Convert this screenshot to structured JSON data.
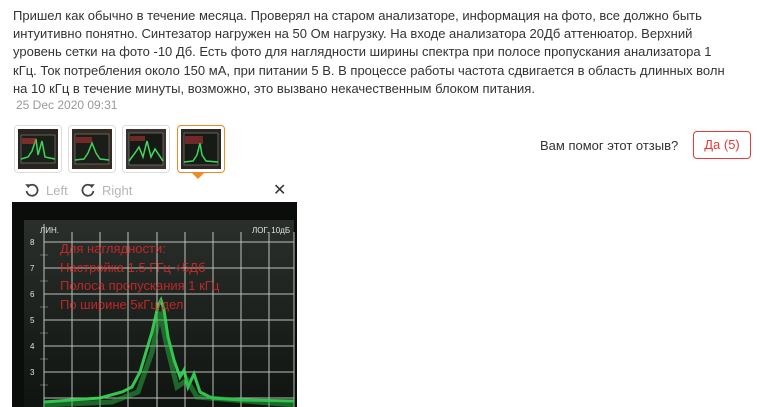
{
  "review": {
    "text": "Пришел как обычно в течение месяца. Проверял на старом анализаторе, информация на фото, все должно быть интуитивно понятно. Синтезатор нагружен на 50 Ом нагрузку. На входе анализатора 20Дб аттенюатор. Верхний уровень сетки на фото -10 Дб. Есть фото для наглядности ширины спектра при полосе пропускания анализатора 1 кГц. Ток потребления около 150 мА, при питании 5 В. В процессе работы частота сдвигается в область длинных волн на 10 кГц в течение минуты, возможно, это вызвано некачественным блоком питания.",
    "date": "25 Dec 2020 09:31"
  },
  "thumbnails": [
    {
      "name": "photo-1"
    },
    {
      "name": "photo-2"
    },
    {
      "name": "photo-3"
    },
    {
      "name": "photo-4",
      "active": true
    }
  ],
  "helpful": {
    "question": "Вам помог этот отзыв?",
    "yes_label": "Да (5)"
  },
  "viewer": {
    "rotate_left_label": "Left",
    "rotate_right_label": "Right",
    "close_icon": "close-icon",
    "photo": {
      "top_left_label": "ЛИН.",
      "top_right_label": "ЛОГ. 10дБ",
      "scale_numbers": [
        "8",
        "7",
        "6",
        "5",
        "4",
        "3"
      ],
      "overlay_lines": [
        "Для наглядности:",
        "Настройка 1.5 ГГц +5Дб",
        "Полоса пропускания 1 кГц",
        "По ширине 5кГц/дел"
      ]
    }
  },
  "colors": {
    "accent_orange": "#f08a24",
    "button_red": "#e53935",
    "spectrum_green": "#37d957"
  }
}
